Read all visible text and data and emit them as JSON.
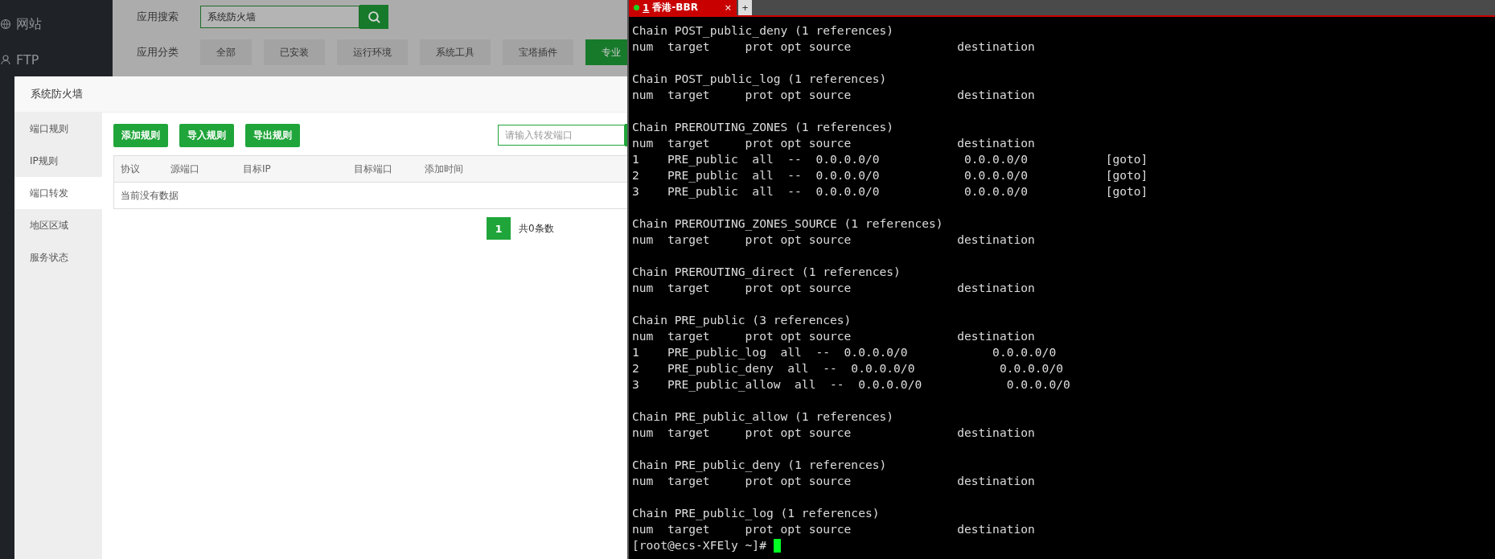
{
  "sidebar": {
    "items": [
      {
        "label": "网站",
        "kind": "globe"
      },
      {
        "label": "FTP",
        "kind": "ftp"
      }
    ]
  },
  "app_store": {
    "search_label": "应用搜索",
    "search_value": "系统防火墙",
    "category_label": "应用分类",
    "categories": [
      {
        "label": "全部",
        "selected": false
      },
      {
        "label": "已安装",
        "selected": false
      },
      {
        "label": "运行环境",
        "selected": false
      },
      {
        "label": "系统工具",
        "selected": false
      },
      {
        "label": "宝塔插件",
        "selected": false
      },
      {
        "label": "专业",
        "selected": true
      }
    ]
  },
  "dialog": {
    "title": "系统防火墙",
    "nav": [
      {
        "label": "端口规则",
        "selected": false
      },
      {
        "label": "IP规则",
        "selected": false
      },
      {
        "label": "端口转发",
        "selected": true
      },
      {
        "label": "地区区域",
        "selected": false
      },
      {
        "label": "服务状态",
        "selected": false
      }
    ],
    "buttons": [
      "添加规则",
      "导入规则",
      "导出规则"
    ],
    "search_placeholder": "请输入转发端口",
    "table": {
      "columns": [
        "协议",
        "源端口",
        "目标IP",
        "目标端口",
        "添加时间"
      ],
      "empty_text": "当前没有数据"
    },
    "pagination": {
      "pages": [
        {
          "label": "1",
          "selected": true
        }
      ],
      "summary": "共0条数"
    }
  },
  "terminal": {
    "tabs": [
      {
        "number": "1",
        "title": "香港-BBR",
        "selected": true,
        "connected": true,
        "close": "×"
      }
    ],
    "new_tab": "+",
    "chains": [
      {
        "header": "Chain POST_public_deny (1 references)",
        "columns": "num  target     prot opt source               destination"
      },
      {
        "header": "Chain POST_public_log (1 references)",
        "columns": "num  target     prot opt source               destination"
      },
      {
        "header": "Chain PREROUTING_ZONES (1 references)",
        "columns": "num  target     prot opt source               destination",
        "rules": [
          "1    PRE_public  all  --  0.0.0.0/0            0.0.0.0/0           [goto]",
          "2    PRE_public  all  --  0.0.0.0/0            0.0.0.0/0           [goto]",
          "3    PRE_public  all  --  0.0.0.0/0            0.0.0.0/0           [goto]"
        ]
      },
      {
        "header": "Chain PREROUTING_ZONES_SOURCE (1 references)",
        "columns": "num  target     prot opt source               destination"
      },
      {
        "header": "Chain PREROUTING_direct (1 references)",
        "columns": "num  target     prot opt source               destination"
      },
      {
        "header": "Chain PRE_public (3 references)",
        "columns": "num  target     prot opt source               destination",
        "rules": [
          "1    PRE_public_log  all  --  0.0.0.0/0            0.0.0.0/0",
          "2    PRE_public_deny  all  --  0.0.0.0/0            0.0.0.0/0",
          "3    PRE_public_allow  all  --  0.0.0.0/0            0.0.0.0/0"
        ]
      },
      {
        "header": "Chain PRE_public_allow (1 references)",
        "columns": "num  target     prot opt source               destination"
      },
      {
        "header": "Chain PRE_public_deny (1 references)",
        "columns": "num  target     prot opt source               destination"
      },
      {
        "header": "Chain PRE_public_log (1 references)",
        "columns": "num  target     prot opt source               destination"
      }
    ],
    "prompt": "[root@ecs-XFEly ~]#"
  }
}
